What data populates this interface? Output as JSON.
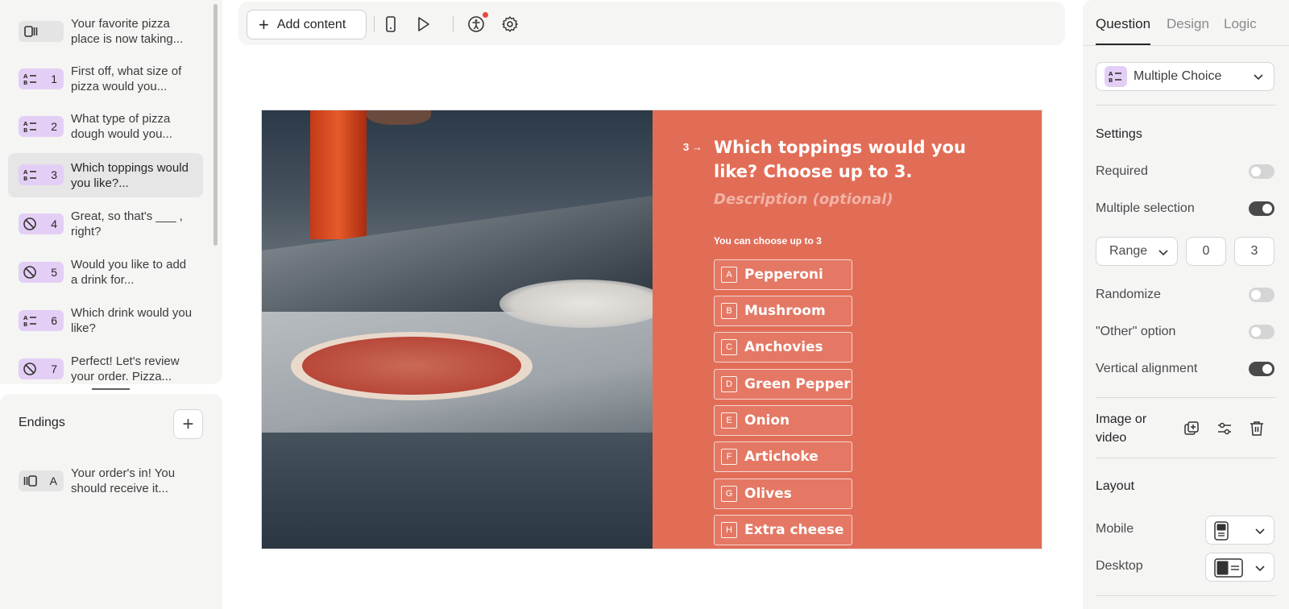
{
  "questions": [
    {
      "num": "",
      "text": "Your favorite pizza place is now taking...",
      "icon": "welcome-screen-icon",
      "active": false
    },
    {
      "num": "1",
      "text": "First off, what size of pizza would you...",
      "icon": "multiple-choice-icon",
      "active": false
    },
    {
      "num": "2",
      "text": "What type of pizza dough would you...",
      "icon": "multiple-choice-icon",
      "active": false
    },
    {
      "num": "3",
      "text": "Which toppings would you like?...",
      "icon": "multiple-choice-icon",
      "active": true
    },
    {
      "num": "4",
      "text": "Great, so that's ___ , right?",
      "icon": "yes-no-icon",
      "active": false
    },
    {
      "num": "5",
      "text": "Would you like to add a drink for...",
      "icon": "yes-no-icon",
      "active": false
    },
    {
      "num": "6",
      "text": "Which drink would you like?",
      "icon": "multiple-choice-icon",
      "active": false
    },
    {
      "num": "7",
      "text": "Perfect! Let's review your order. Pizza...",
      "icon": "yes-no-icon",
      "active": false
    }
  ],
  "endings": {
    "title": "Endings",
    "add_label": "+",
    "items": [
      {
        "num": "A",
        "text": "Your order's in! You should receive it..."
      }
    ]
  },
  "toolbar": {
    "add_content_label": "Add content",
    "icons": [
      "mobile-preview-icon",
      "play-icon",
      "accessibility-icon",
      "settings-gear-icon"
    ]
  },
  "preview": {
    "index": "3",
    "title": "Which toppings would you like? Choose up to 3.",
    "description_placeholder": "Description (optional)",
    "hint": "You can choose up to 3",
    "choices": [
      {
        "key": "A",
        "label": "Pepperoni"
      },
      {
        "key": "B",
        "label": "Mushroom"
      },
      {
        "key": "C",
        "label": "Anchovies"
      },
      {
        "key": "D",
        "label": "Green Pepper"
      },
      {
        "key": "E",
        "label": "Onion"
      },
      {
        "key": "F",
        "label": "Artichoke"
      },
      {
        "key": "G",
        "label": "Olives"
      },
      {
        "key": "H",
        "label": "Extra cheese"
      }
    ],
    "accent_color": "#e26d57"
  },
  "right_panel": {
    "tabs": [
      "Question",
      "Design",
      "Logic"
    ],
    "active_tab": "Question",
    "type_label": "Multiple Choice",
    "settings_heading": "Settings",
    "required_label": "Required",
    "required_on": false,
    "multiple_label": "Multiple selection",
    "multiple_on": true,
    "range_label": "Range",
    "range_min": "0",
    "range_max": "3",
    "randomize_label": "Randomize",
    "randomize_on": false,
    "other_label": "\"Other\" option",
    "other_on": false,
    "vertical_label": "Vertical alignment",
    "vertical_on": true,
    "media_label": "Image or video",
    "layout_heading": "Layout",
    "mobile_label": "Mobile",
    "desktop_label": "Desktop"
  }
}
